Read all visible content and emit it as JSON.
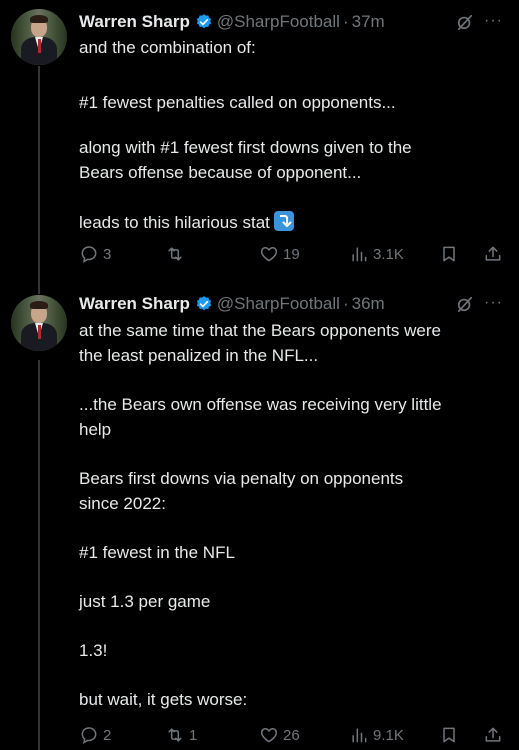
{
  "tweets": [
    {
      "author": {
        "name": "Warren Sharp",
        "handle": "@SharpFootball"
      },
      "dot": "·",
      "time": "37m",
      "lines": [
        "and the combination of:",
        "",
        "#1 fewest penalties called on opponents...",
        "",
        "along with #1 fewest first downs given to the",
        "Bears offense because of opponent...",
        "",
        "leads to this hilarious stat"
      ],
      "actions": {
        "replies": "3",
        "reposts": "",
        "likes": "19",
        "views": "3.1K"
      }
    },
    {
      "author": {
        "name": "Warren Sharp",
        "handle": "@SharpFootball"
      },
      "dot": "·",
      "time": "36m",
      "lines": [
        "at the same time that the Bears opponents were",
        "the least penalized in the NFL...",
        "",
        "...the Bears own offense was receiving very little",
        "help",
        "",
        "Bears first downs via penalty on opponents",
        "since 2022:",
        "",
        "#1 fewest in the NFL",
        "",
        "just 1.3 per game",
        "",
        "1.3!",
        "",
        "but wait, it gets worse:"
      ],
      "actions": {
        "replies": "2",
        "reposts": "1",
        "likes": "26",
        "views": "9.1K"
      }
    }
  ],
  "icons": {
    "reply": "reply-icon",
    "repost": "repost-icon",
    "like": "heart-icon",
    "views": "views-icon",
    "bookmark": "bookmark-icon",
    "share": "share-icon",
    "verified": "verified-badge-icon",
    "grok": "grok-icon",
    "more": "more-icon",
    "arrow_emoji": "arrow-down-emoji-icon"
  },
  "colors": {
    "background": "#000000",
    "text": "#e7e9ea",
    "muted": "#71767b",
    "verified": "#1d9bf0",
    "thread_line": "#333639"
  }
}
